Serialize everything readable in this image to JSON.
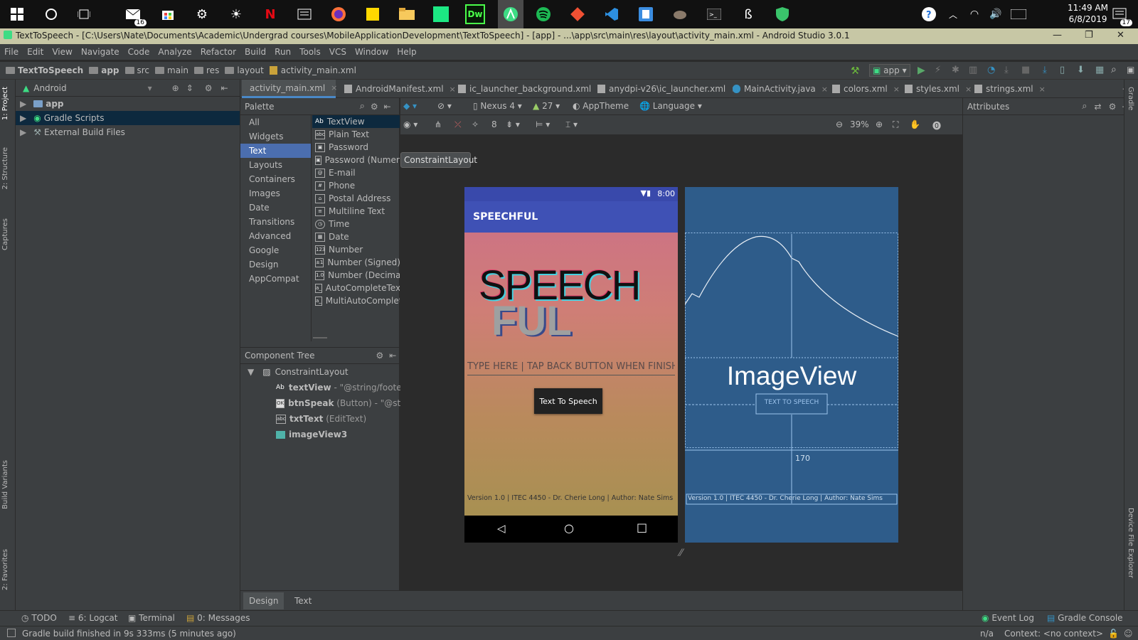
{
  "taskbar": {
    "mail_badge": "16",
    "notification_count": "17",
    "time": "11:49 AM",
    "date": "6/8/2019"
  },
  "window": {
    "title": "TextToSpeech - [C:\\Users\\Nate\\Documents\\Academic\\Undergrad courses\\MobileApplicationDevelopment\\TextToSpeech] - [app] - ...\\app\\src\\main\\res\\layout\\activity_main.xml - Android Studio 3.0.1"
  },
  "menu": [
    "File",
    "Edit",
    "View",
    "Navigate",
    "Code",
    "Analyze",
    "Refactor",
    "Build",
    "Run",
    "Tools",
    "VCS",
    "Window",
    "Help"
  ],
  "breadcrumb": [
    "TextToSpeech",
    "app",
    "src",
    "main",
    "res",
    "layout",
    "activity_main.xml"
  ],
  "run_config": "app",
  "left_tools": [
    "1: Project",
    "2: Structure",
    "Captures",
    "Build Variants",
    "2: Favorites"
  ],
  "project": {
    "view_mode": "Android",
    "tree": [
      {
        "label": "app",
        "bold": true
      },
      {
        "label": "Gradle Scripts",
        "selected": true
      },
      {
        "label": "External Build Files"
      }
    ]
  },
  "editor_tabs": [
    "activity_main.xml",
    "AndroidManifest.xml",
    "ic_launcher_background.xml",
    "anydpi-v26\\ic_launcher.xml",
    "MainActivity.java",
    "colors.xml",
    "styles.xml",
    "strings.xml"
  ],
  "palette": {
    "title": "Palette",
    "categories": [
      "All",
      "Widgets",
      "Text",
      "Layouts",
      "Containers",
      "Images",
      "Date",
      "Transitions",
      "Advanced",
      "Google",
      "Design",
      "AppCompat"
    ],
    "selected_category": "Text",
    "widgets": [
      {
        "icon": "Ab",
        "label": "TextView"
      },
      {
        "icon": "abc",
        "label": "Plain Text"
      },
      {
        "icon": "lock",
        "label": "Password"
      },
      {
        "icon": "lock",
        "label": "Password (Numeric)"
      },
      {
        "icon": "@",
        "label": "E-mail"
      },
      {
        "icon": "#",
        "label": "Phone"
      },
      {
        "icon": "home",
        "label": "Postal Address"
      },
      {
        "icon": "lines",
        "label": "Multiline Text"
      },
      {
        "icon": "clock",
        "label": "Time"
      },
      {
        "icon": "cal",
        "label": "Date"
      },
      {
        "icon": "123",
        "label": "Number"
      },
      {
        "icon": "+1",
        "label": "Number (Signed)"
      },
      {
        "icon": "1.0",
        "label": "Number (Decimal)"
      },
      {
        "icon": "a_",
        "label": "AutoCompleteTextView"
      },
      {
        "icon": "a_",
        "label": "MultiAutoCompleteTextView"
      }
    ]
  },
  "component_tree": {
    "title": "Component Tree",
    "root": "ConstraintLayout",
    "children": [
      {
        "name": "textView",
        "detail": "- \"@string/footer\""
      },
      {
        "name": "btnSpeak",
        "detail": "(Button) - \"@string/...\""
      },
      {
        "name": "txtText",
        "detail": "(EditText)"
      },
      {
        "name": "imageView3",
        "detail": ""
      }
    ]
  },
  "design_toolbar": {
    "device": "Nexus 4",
    "api": "27",
    "theme": "AppTheme",
    "language": "Language",
    "margin": "8",
    "zoom": "39%",
    "tooltip": "ConstraintLayout"
  },
  "preview": {
    "status_time": "8:00",
    "app_title": "SPEECHFUL",
    "logo_line1": "SPEECH",
    "logo_line2": "FUL",
    "input_hint": "TYPE HERE | TAP BACK BUTTON WHEN FINISHED",
    "button": "Text To Speech",
    "footer": "Version 1.0 | ITEC 4450 - Dr. Cherie Long | Author: Nate Sims"
  },
  "blueprint": {
    "image_label": "ImageView",
    "button_label": "TEXT TO SPEECH",
    "margin_value": "170",
    "footer": "Version 1.0 | ITEC 4450 - Dr. Cherie Long | Author: Nate Sims"
  },
  "attributes_title": "Attributes",
  "right_tools": [
    "Gradle",
    "Device File Explorer"
  ],
  "bottom_tabs": [
    "Design",
    "Text"
  ],
  "tool_windows": [
    "TODO",
    "6: Logcat",
    "Terminal",
    "0: Messages"
  ],
  "tool_windows_right": [
    "Event Log",
    "Gradle Console"
  ],
  "status": {
    "message": "Gradle build finished in 9s 333ms (5 minutes ago)",
    "position": "n/a",
    "context": "Context: <no context>"
  }
}
